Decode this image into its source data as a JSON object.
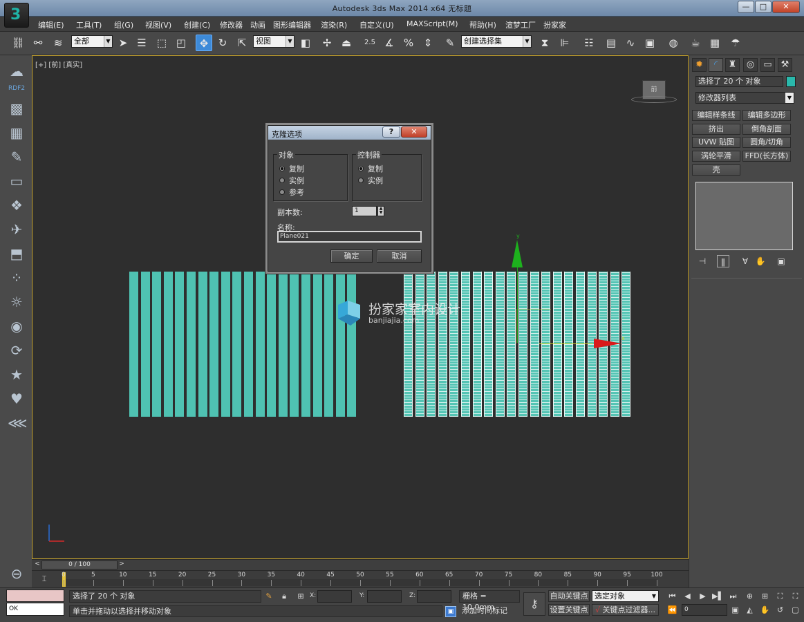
{
  "window": {
    "title": "Autodesk 3ds Max  2014 x64      无标题",
    "minimize": "—",
    "maximize": "□",
    "close": "✕"
  },
  "menu": [
    "编辑(E)",
    "工具(T)",
    "组(G)",
    "视图(V)",
    "创建(C)",
    "修改器",
    "动画",
    "图形编辑器",
    "渲染(R)",
    "自定义(U)",
    "MAXScript(M)",
    "帮助(H)",
    "渲梦工厂",
    "扮家家"
  ],
  "toolbar": {
    "filter_value": "全部",
    "coord_value": "视图",
    "named_selection": "创建选择集",
    "snap_label": "2.5"
  },
  "sidebar": {
    "rdf_label": "RDF2"
  },
  "viewport": {
    "label": "[+] [前] [真实]",
    "viewcube_label": "前",
    "gizmo_y": "y",
    "gizmo_x": "x",
    "watermark_name": "扮家家室内设计",
    "watermark_url": "banjiajia.com"
  },
  "clone_dialog": {
    "title": "克隆选项",
    "help": "?",
    "close": "✕",
    "object_group": "对象",
    "object_options": [
      "复制",
      "实例",
      "参考"
    ],
    "object_selected": "复制",
    "controller_group": "控制器",
    "controller_options": [
      "复制",
      "实例"
    ],
    "controller_selected": "复制",
    "copies_label": "副本数:",
    "copies_value": "1",
    "name_label": "名称:",
    "name_value": "Plane021",
    "ok": "确定",
    "cancel": "取消"
  },
  "command_panel": {
    "selection_text": "选择了 20 个 对象",
    "modifier_list": "修改器列表",
    "buttons": [
      "编辑样条线",
      "编辑多边形",
      "挤出",
      "倒角剖面",
      "UVW 贴图",
      "圆角/切角",
      "涡轮平滑",
      "FFD(长方体)",
      "壳"
    ]
  },
  "timeline": {
    "frame_display": "0 / 100",
    "prev": "<",
    "next": ">",
    "ticks": [
      "0",
      "5",
      "10",
      "15",
      "20",
      "25",
      "30",
      "35",
      "40",
      "45",
      "50",
      "55",
      "60",
      "65",
      "70",
      "75",
      "80",
      "85",
      "90",
      "95",
      "100"
    ]
  },
  "status": {
    "maxscript_output": "OK",
    "selection": "选择了 20 个 对象",
    "prompt": "单击并拖动以选择并移动对象",
    "x_label": "X:",
    "y_label": "Y:",
    "z_label": "Z:",
    "grid": "栅格 = 10.0mm",
    "add_time_tag": "添加时间标记",
    "auto_key": "自动关键点",
    "set_key": "设置关键点",
    "selected_dropdown": "选定对象",
    "key_filters": "关键点过滤器...",
    "current_frame": "0"
  }
}
